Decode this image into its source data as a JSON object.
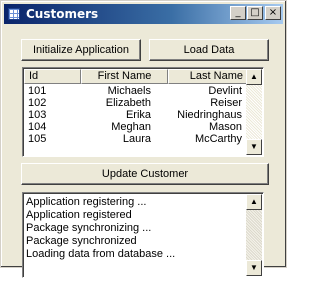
{
  "window": {
    "title": "Customers",
    "controls": {
      "minimize": "_",
      "maximize": "□",
      "close": "×"
    }
  },
  "toolbar": {
    "init_label": "Initialize Application",
    "load_label": "Load Data"
  },
  "customers": {
    "columns": [
      "Id",
      "First Name",
      "Last Name"
    ],
    "rows": [
      {
        "id": "101",
        "first": "Michaels",
        "last": "Devlint"
      },
      {
        "id": "102",
        "first": "Elizabeth",
        "last": "Reiser"
      },
      {
        "id": "103",
        "first": "Erika",
        "last": "Niedringhaus"
      },
      {
        "id": "104",
        "first": "Meghan",
        "last": "Mason"
      },
      {
        "id": "105",
        "first": "Laura",
        "last": "McCarthy"
      }
    ]
  },
  "actions": {
    "update_label": "Update Customer"
  },
  "log": {
    "lines": [
      "Application registering ...",
      "Application registered",
      "Package synchronizing ...",
      "Package synchronized",
      "Loading data from database ..."
    ]
  },
  "icons": {
    "scroll_up": "▲",
    "scroll_down": "▼"
  }
}
